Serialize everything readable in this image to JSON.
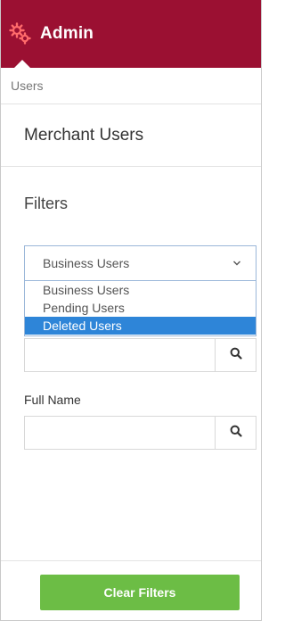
{
  "header": {
    "title": "Admin",
    "color": "#9b1032",
    "icon": "gears-icon"
  },
  "breadcrumb": {
    "label": "Users"
  },
  "section": {
    "title": "Merchant Users"
  },
  "filters": {
    "title": "Filters",
    "user_type_select": {
      "selected": "Business Users",
      "options": [
        "Business Users",
        "Pending Users",
        "Deleted Users"
      ],
      "highlighted": "Deleted Users"
    },
    "search_input": {
      "value": "",
      "placeholder": "",
      "button_icon": "search-icon"
    },
    "full_name": {
      "label": "Full Name",
      "value": "",
      "placeholder": "",
      "button_icon": "search-icon"
    }
  },
  "footer": {
    "clear_label": "Clear Filters",
    "clear_color": "#6cbd45"
  }
}
